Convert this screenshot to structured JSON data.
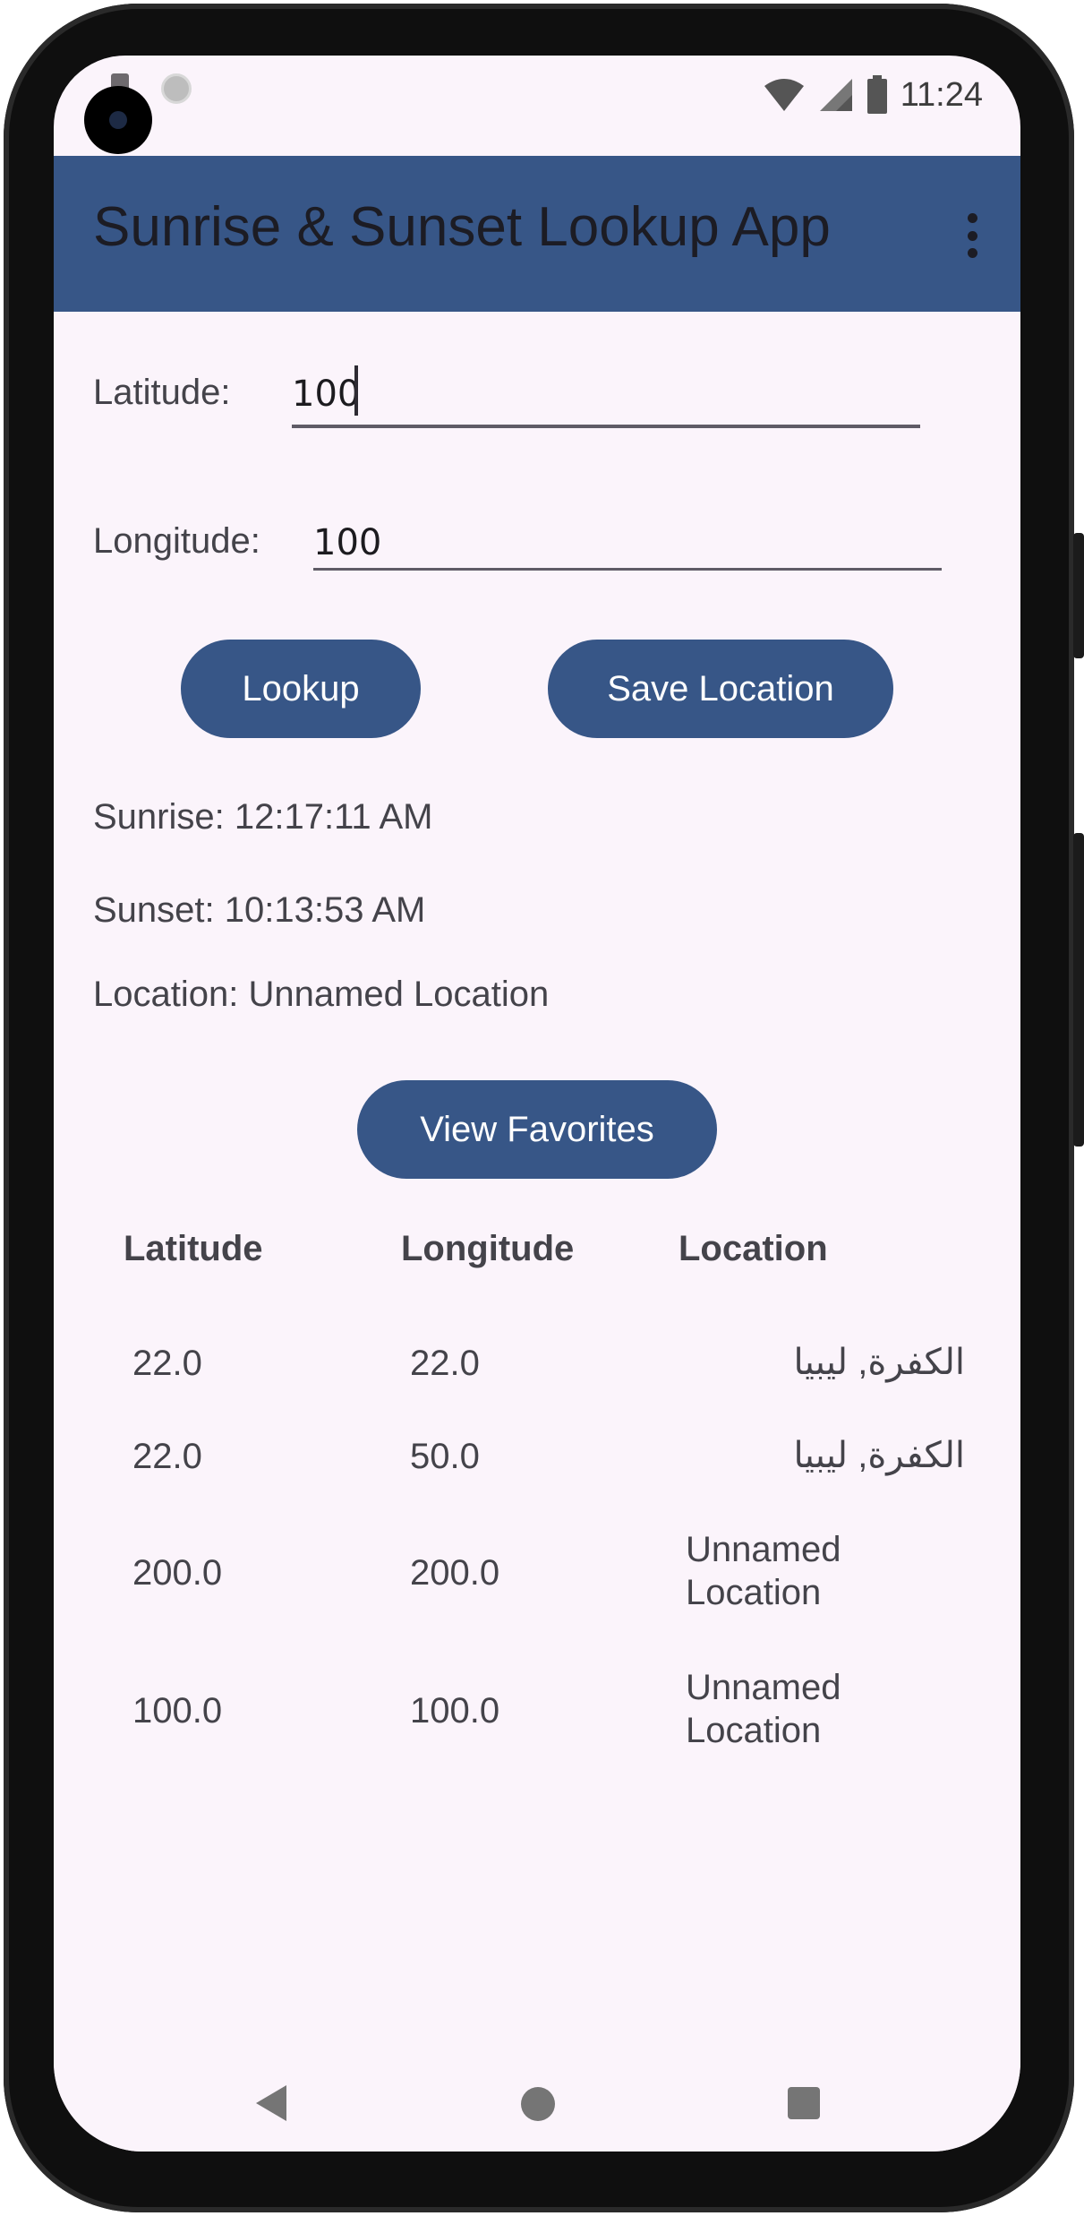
{
  "status_bar": {
    "time": "11:24",
    "icons": [
      "camera-icon",
      "sd-card-icon",
      "sync-icon",
      "wifi-icon",
      "signal-icon",
      "battery-icon"
    ]
  },
  "app_bar": {
    "title": "Sunrise & Sunset Lookup App",
    "menu_icon": "more-vert-icon",
    "background": "#375687"
  },
  "form": {
    "latitude_label": "Latitude:",
    "latitude_value": "100",
    "longitude_label": "Longitude:",
    "longitude_value": "100"
  },
  "buttons": {
    "lookup": "Lookup",
    "save_location": "Save Location",
    "view_favorites": "View Favorites"
  },
  "results": {
    "sunrise": "Sunrise: 12:17:11 AM",
    "sunset": "Sunset: 10:13:53 AM",
    "location": "Location: Unnamed Location"
  },
  "favorites": {
    "headers": [
      "Latitude",
      "Longitude",
      "Location"
    ],
    "rows": [
      {
        "latitude": "22.0",
        "longitude": "22.0",
        "location": "الكفرة, ليبيا"
      },
      {
        "latitude": "22.0",
        "longitude": "50.0",
        "location": "الكفرة, ليبيا"
      },
      {
        "latitude": "200.0",
        "longitude": "200.0",
        "location": "Unnamed Location"
      },
      {
        "latitude": "100.0",
        "longitude": "100.0",
        "location": "Unnamed Location"
      }
    ]
  },
  "nav_bar": {
    "icons": [
      "back-icon",
      "home-icon",
      "recents-icon"
    ]
  }
}
